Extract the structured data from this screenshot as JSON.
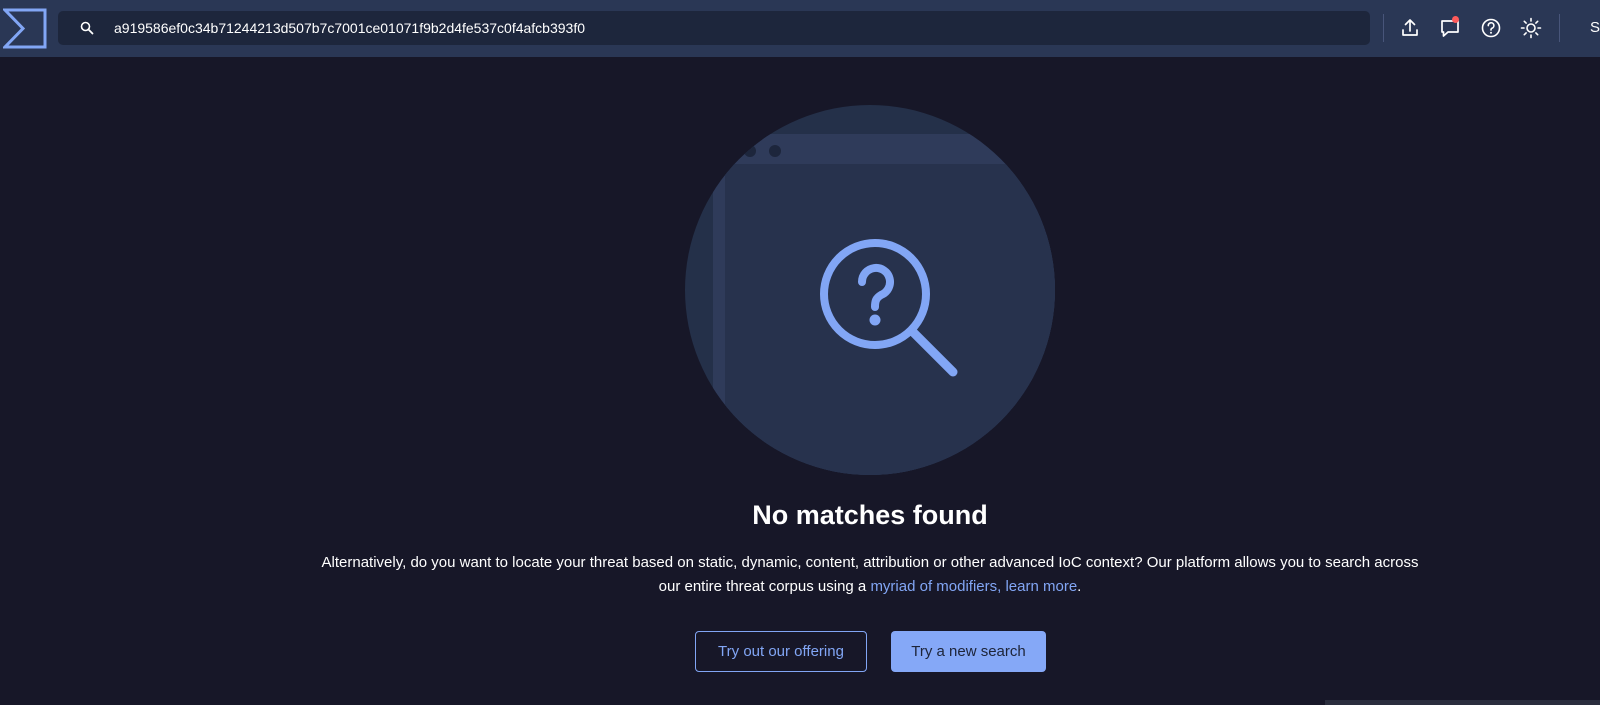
{
  "search": {
    "value": "a919586ef0c34b71244213d507b7c7001ce01071f9b2d4fe537c0f4afcb393f0",
    "icon": "search-icon"
  },
  "toolbar": {
    "icons": [
      "upload-icon",
      "feedback-icon",
      "help-icon",
      "theme-icon"
    ],
    "user_initial": "S"
  },
  "empty_state": {
    "title": "No matches found",
    "description_part1": "Alternatively, do you want to locate your threat based on static, dynamic, content, attribution or other advanced IoC context? Our platform allows you to search across our entire threat corpus using a ",
    "link_text": "myriad of modifiers, learn more",
    "description_end": ".",
    "buttons": {
      "secondary": "Try out our offering",
      "primary": "Try a new search"
    }
  },
  "colors": {
    "topbar": "#2a3755",
    "background": "#171728",
    "accent": "#82a6f5",
    "illustration_circle": "#243049"
  }
}
